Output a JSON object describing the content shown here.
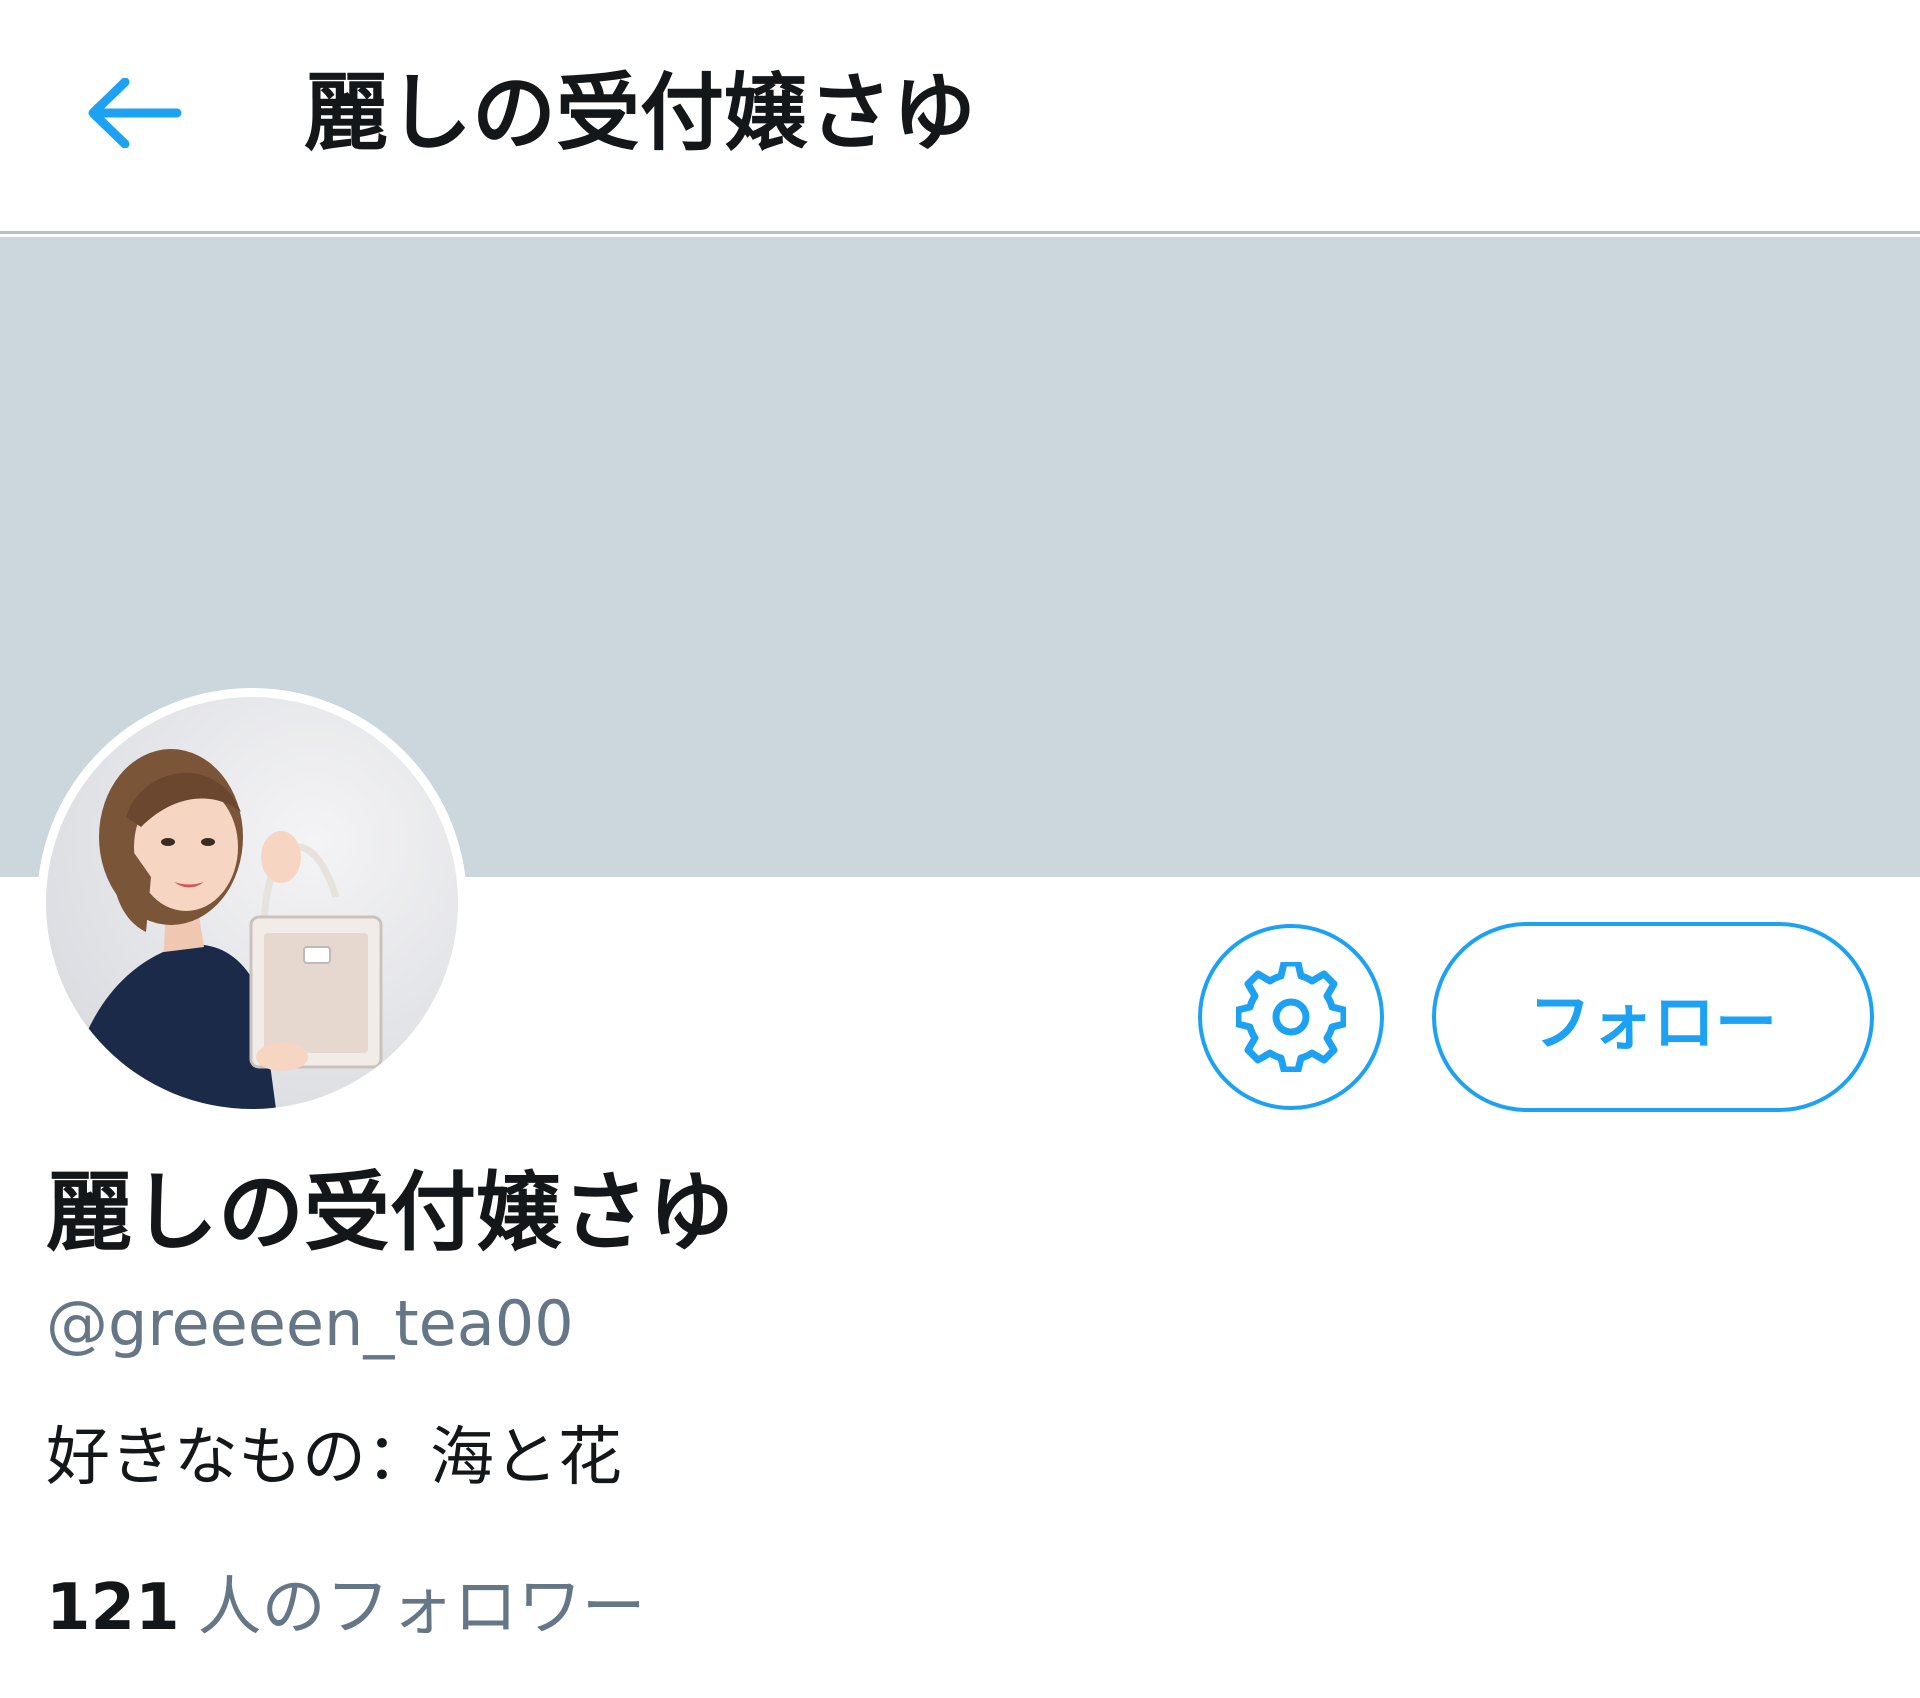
{
  "header": {
    "title": "麗しの受付嬢さゆ"
  },
  "profile": {
    "display_name": "麗しの受付嬢さゆ",
    "handle": "@greeeen_tea00",
    "bio": "好きなもの：海と花",
    "followers_count": "121",
    "followers_label": "人のフォロワー"
  },
  "actions": {
    "follow_label": "フォロー"
  },
  "icons": {
    "back": "arrow-left-icon",
    "settings": "gear-icon"
  },
  "colors": {
    "accent": "#1da1f2",
    "banner": "#ccd6dd",
    "secondary_text": "#657786",
    "primary_text": "#14171a"
  }
}
